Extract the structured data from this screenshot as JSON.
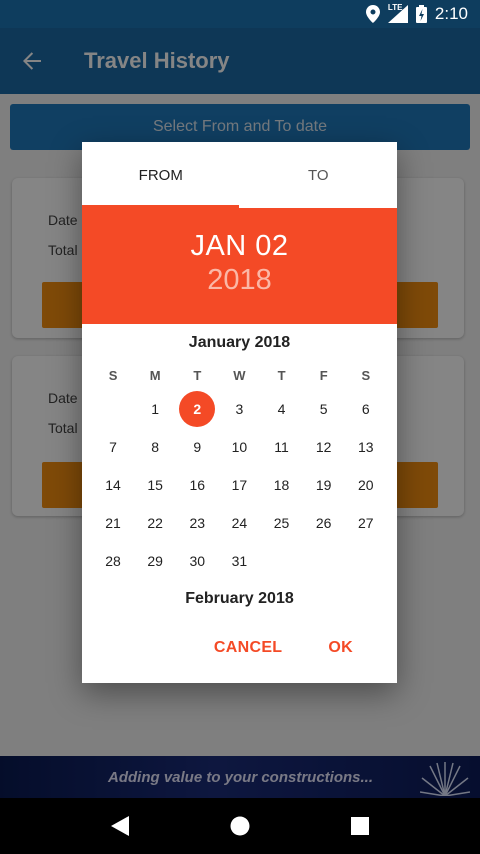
{
  "status_bar": {
    "network": "LTE",
    "time": "2:10"
  },
  "app_bar": {
    "title": "Travel History",
    "back_icon": "arrow-back-icon"
  },
  "content": {
    "select_button": "Select From and To date",
    "cards": [
      {
        "date_label": "Date",
        "total_label": "Total"
      },
      {
        "date_label": "Date",
        "total_label": "Total"
      }
    ]
  },
  "banner": {
    "text": "Adding value to your constructions..."
  },
  "dialog": {
    "tabs": [
      {
        "label": "FROM",
        "active": true
      },
      {
        "label": "TO",
        "active": false
      }
    ],
    "header_date": "JAN 02",
    "header_year": "2018",
    "month_title": "January 2018",
    "next_month_title": "February 2018",
    "weekdays": [
      "S",
      "M",
      "T",
      "W",
      "T",
      "F",
      "S"
    ],
    "first_weekday_offset": 1,
    "days": [
      "1",
      "2",
      "3",
      "4",
      "5",
      "6",
      "7",
      "8",
      "9",
      "10",
      "11",
      "12",
      "13",
      "14",
      "15",
      "16",
      "17",
      "18",
      "19",
      "20",
      "21",
      "22",
      "23",
      "24",
      "25",
      "26",
      "27",
      "28",
      "29",
      "30",
      "31"
    ],
    "selected_day": "2",
    "cancel_label": "CANCEL",
    "ok_label": "OK"
  },
  "colors": {
    "accent": "#f44a26",
    "app_bar": "#1c6aa6",
    "status_bar": "#0e3d5e",
    "card_button": "#f48e10"
  }
}
